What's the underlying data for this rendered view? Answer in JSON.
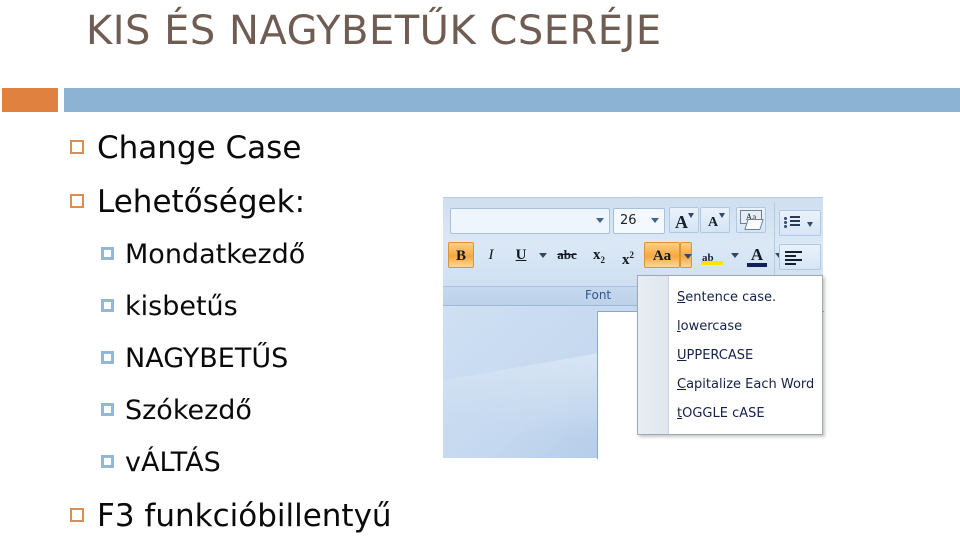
{
  "slide": {
    "title": "KIS ÉS NAGYBETŰK CSERÉJE",
    "title_color": "#6f5c53",
    "accent_orange": "#e0813f",
    "accent_blue": "#8db3d4"
  },
  "bullets": [
    {
      "level": 1,
      "text": "Change Case",
      "marker": "orange-hollow-square"
    },
    {
      "level": 1,
      "text": "Lehetőségek:",
      "marker": "orange-hollow-square"
    },
    {
      "level": 2,
      "text": "Mondatkezdő",
      "marker": "blue-hollow-square"
    },
    {
      "level": 2,
      "text": "kisbetűs",
      "marker": "blue-hollow-square"
    },
    {
      "level": 2,
      "text": "NAGYBETŰS",
      "marker": "blue-hollow-square"
    },
    {
      "level": 2,
      "text": "Szókezdő",
      "marker": "blue-hollow-square"
    },
    {
      "level": 2,
      "text": "vÁLTÁS",
      "marker": "blue-hollow-square"
    },
    {
      "level": 1,
      "text": "F3 funkcióbillentyű",
      "marker": "orange-hollow-square"
    }
  ],
  "ribbon": {
    "font_name_value": "",
    "font_name_placeholder": "",
    "font_size_value": "26",
    "group_label": "Font",
    "buttons_row1": [
      {
        "name": "grow-font-button",
        "label": "A"
      },
      {
        "name": "shrink-font-button",
        "label": "A"
      },
      {
        "name": "clear-formatting-button",
        "label": "Aa"
      }
    ],
    "buttons_row2": [
      {
        "name": "bold-button",
        "label": "B",
        "state": "active"
      },
      {
        "name": "italic-button",
        "label": "I",
        "state": "normal"
      },
      {
        "name": "underline-button",
        "label": "U",
        "state": "normal"
      },
      {
        "name": "strikethrough-button",
        "label": "abc",
        "state": "normal"
      },
      {
        "name": "subscript-button",
        "label": "x",
        "sub": "2",
        "state": "normal"
      },
      {
        "name": "superscript-button",
        "label": "x",
        "sup": "2",
        "state": "normal"
      },
      {
        "name": "change-case-button",
        "label": "Aa",
        "state": "active"
      },
      {
        "name": "text-highlight-button",
        "label": "ab",
        "state": "normal"
      },
      {
        "name": "font-color-button",
        "label": "A",
        "state": "normal"
      }
    ],
    "highlight_color": "#ffe400",
    "font_color": "#10205a",
    "active_button_color": "#f6a83e"
  },
  "case_menu": {
    "items": [
      {
        "accel": "S",
        "rest": "entence case."
      },
      {
        "accel": "l",
        "rest": "owercase"
      },
      {
        "accel": "U",
        "rest": "PPERCASE"
      },
      {
        "accel": "C",
        "rest": "apitalize Each Word"
      },
      {
        "accel": "t",
        "rest": "OGGLE cASE"
      }
    ]
  }
}
